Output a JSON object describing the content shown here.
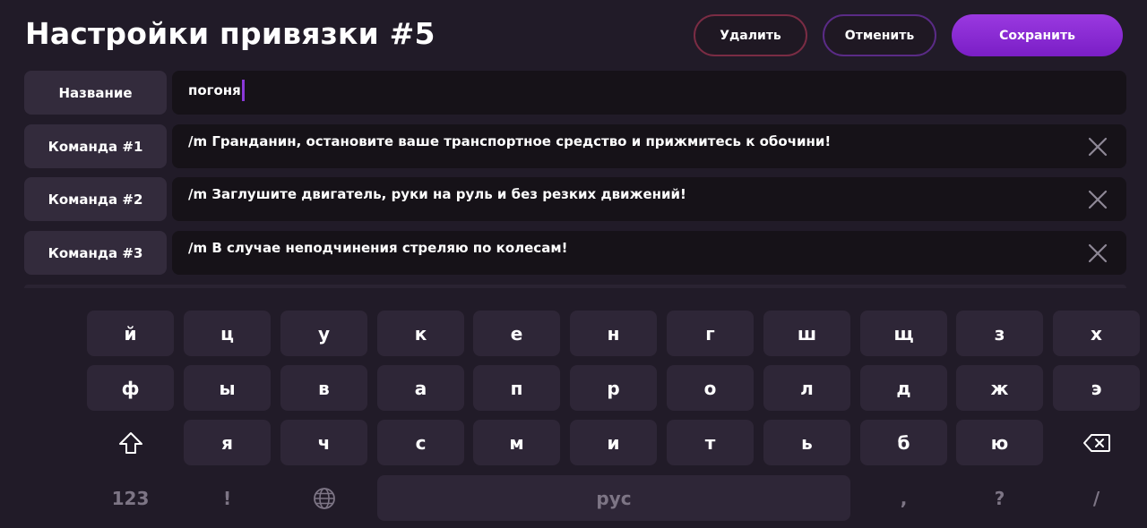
{
  "header": {
    "title": "Настройки привязки #5",
    "delete_label": "Удалить",
    "cancel_label": "Отменить",
    "save_label": "Сохранить"
  },
  "rows": [
    {
      "label": "Название",
      "value": "погоня",
      "has_caret": true,
      "closable": false
    },
    {
      "label": "Команда #1",
      "value": "/m Гранданин, остановите ваше транспортное средство и прижмитесь к обочини!",
      "closable": true
    },
    {
      "label": "Команда #2",
      "value": "/m Заглушите двигатель, руки на руль и без резких движений!",
      "closable": true
    },
    {
      "label": "Команда #3",
      "value": "/m В случае неподчинения стреляю по колесам!",
      "closable": true
    }
  ],
  "keyboard": {
    "row1": [
      "й",
      "ц",
      "у",
      "к",
      "е",
      "н",
      "г",
      "ш",
      "щ",
      "з",
      "х"
    ],
    "row2": [
      "ф",
      "ы",
      "в",
      "а",
      "п",
      "р",
      "о",
      "л",
      "д",
      "ж",
      "э"
    ],
    "row3": [
      "я",
      "ч",
      "с",
      "м",
      "и",
      "т",
      "ь",
      "б",
      "ю"
    ],
    "row4": {
      "numbers": "123",
      "exclamation": "!",
      "space": "рус",
      "comma": ",",
      "question": "?",
      "slash": "/"
    },
    "icons": {
      "shift": "shift-icon",
      "backspace": "backspace-icon",
      "language": "globe-icon"
    }
  },
  "colors": {
    "background": "#211b28",
    "accent": "#8a38d8",
    "delete_border": "#7a2c44",
    "cancel_border": "#5a2b86"
  }
}
